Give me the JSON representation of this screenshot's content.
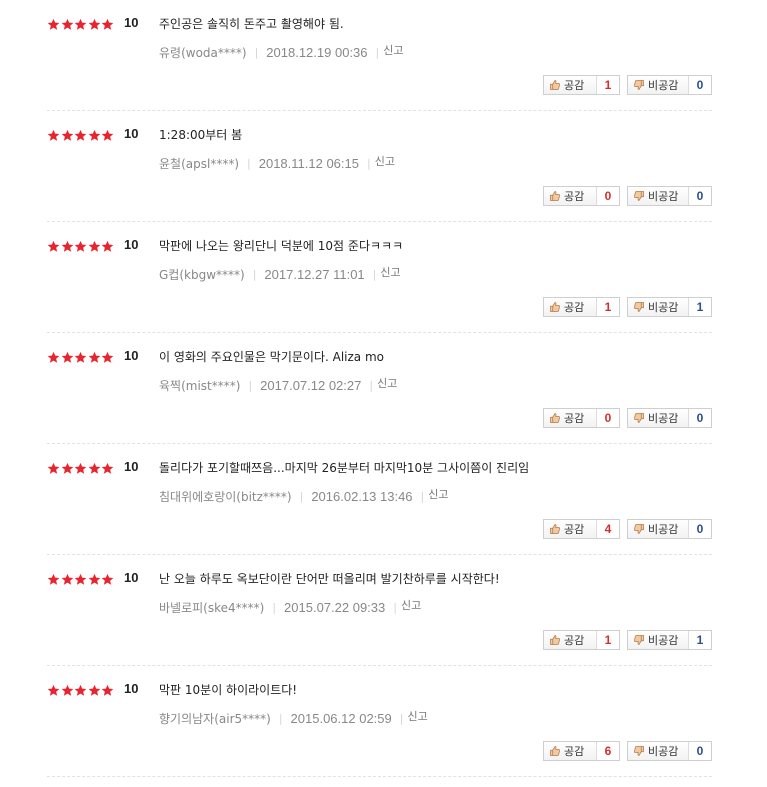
{
  "colors": {
    "star": "#e8242f",
    "up_count": "#d12f2f",
    "down_count": "#2b4f8a"
  },
  "icons": {
    "star": "star-icon",
    "like": "thumbs-up-icon",
    "dislike": "thumbs-down-icon"
  },
  "labels": {
    "like": "공감",
    "dislike": "비공감",
    "report": "신고"
  },
  "reviews": [
    {
      "stars": 5,
      "score": "10",
      "text": "주인공은 솔직히 돈주고 촬영해야 됨.",
      "user": "유령(woda****)",
      "date": "2018.12.19 00:36",
      "likes": "1",
      "dislikes": "0"
    },
    {
      "stars": 5,
      "score": "10",
      "text": "1:28:00부터 봄",
      "user": "윤철(apsl****)",
      "date": "2018.11.12 06:15",
      "likes": "0",
      "dislikes": "0"
    },
    {
      "stars": 5,
      "score": "10",
      "text": "막판에 나오는 왕리단니 덕분에 10점 준다ㅋㅋㅋ",
      "user": "G컵(kbgw****)",
      "date": "2017.12.27 11:01",
      "likes": "1",
      "dislikes": "1"
    },
    {
      "stars": 5,
      "score": "10",
      "text": "이 영화의 주요인물은 막기문이다. Aliza mo",
      "user": "육찍(mist****)",
      "date": "2017.07.12 02:27",
      "likes": "0",
      "dislikes": "0"
    },
    {
      "stars": 5,
      "score": "10",
      "text": "돌리다가 포기할때쯔음...마지막 26분부터 마지막10분 그사이쯤이 진리임",
      "user": "침대위에호랑이(bitz****)",
      "date": "2016.02.13 13:46",
      "likes": "4",
      "dislikes": "0"
    },
    {
      "stars": 5,
      "score": "10",
      "text": "난 오늘 하루도 옥보단이란 단어만 떠올리며 발기찬하루를 시작한다!",
      "user": "바넬로피(ske4****)",
      "date": "2015.07.22 09:33",
      "likes": "1",
      "dislikes": "1"
    },
    {
      "stars": 5,
      "score": "10",
      "text": "막판 10분이 하이라이트다!",
      "user": "향기의남자(air5****)",
      "date": "2015.06.12 02:59",
      "likes": "6",
      "dislikes": "0"
    }
  ]
}
